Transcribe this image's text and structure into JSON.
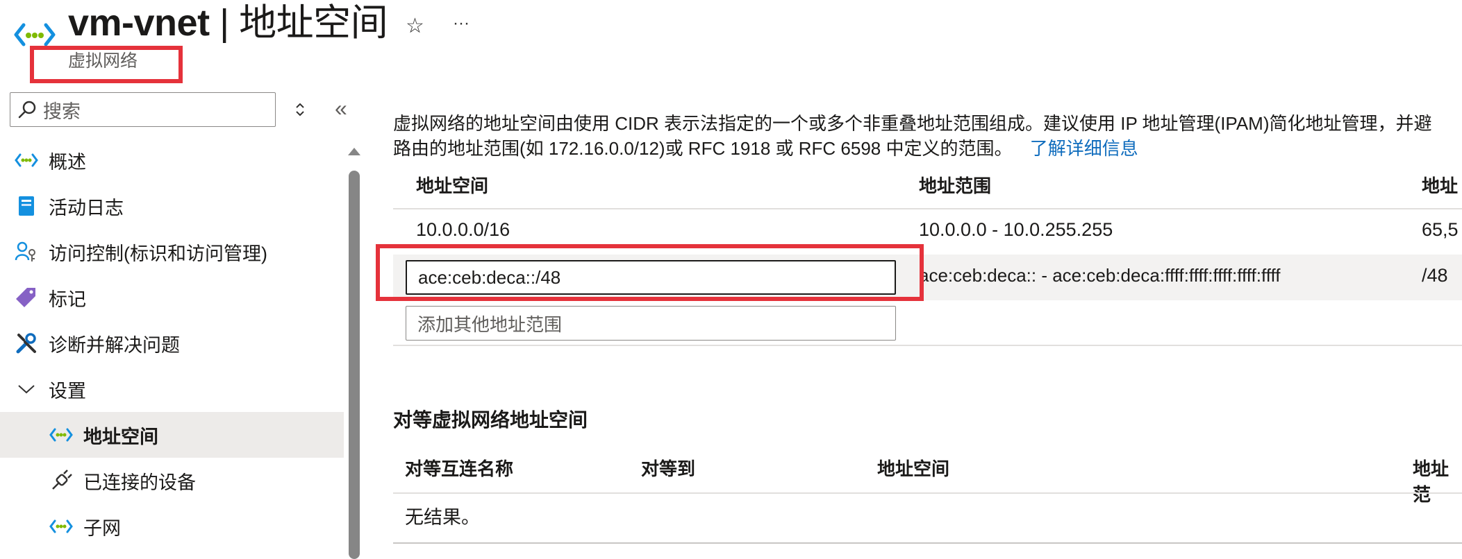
{
  "header": {
    "resource_name": "vm-vnet",
    "separator": " | ",
    "page_name": "地址空间",
    "resource_type": "虚拟网络",
    "favorite_glyph": "☆",
    "more_glyph": "···"
  },
  "sidebar": {
    "search_placeholder": "搜索",
    "collapse_glyph": "«",
    "items": [
      {
        "label": "概述",
        "icon": "vnet-icon"
      },
      {
        "label": "活动日志",
        "icon": "activity-log-icon"
      },
      {
        "label": "访问控制(标识和访问管理)",
        "icon": "access-control-icon"
      },
      {
        "label": "标记",
        "icon": "tag-icon"
      },
      {
        "label": "诊断并解决问题",
        "icon": "wrench-icon"
      },
      {
        "label": "设置",
        "icon": "chevron-down-icon"
      },
      {
        "label": "地址空间",
        "icon": "vnet-icon",
        "selected": true
      },
      {
        "label": "已连接的设备",
        "icon": "plug-icon"
      },
      {
        "label": "子网",
        "icon": "vnet-icon"
      }
    ]
  },
  "main": {
    "description_line1": "虚拟网络的地址空间由使用 CIDR 表示法指定的一个或多个非重叠地址范围组成。建议使用 IP 地址管理(IPAM)简化地址管理，并避",
    "description_line2": "路由的地址范围(如 172.16.0.0/12)或 RFC 1918 或 RFC 6598 中定义的范围。",
    "learn_more": "了解详细信息",
    "address_table": {
      "columns": [
        "地址空间",
        "地址范围",
        "地址"
      ],
      "rows": [
        {
          "space": "10.0.0.0/16",
          "range": "10.0.0.0 - 10.0.255.255",
          "count": "65,5"
        },
        {
          "space": "ace:ceb:deca::/48",
          "range": "ace:ceb:deca:: - ace:ceb:deca:ffff:ffff:ffff:ffff:ffff",
          "count": "/48"
        }
      ],
      "add_placeholder": "添加其他地址范围"
    },
    "peering": {
      "title": "对等虚拟网络地址空间",
      "columns": [
        "对等互连名称",
        "对等到",
        "地址空间",
        "地址范"
      ],
      "empty": "无结果。"
    }
  },
  "colors": {
    "accent": "#0f6cbd",
    "highlight_box": "#e5323b",
    "selected_bg": "#edebe9"
  }
}
